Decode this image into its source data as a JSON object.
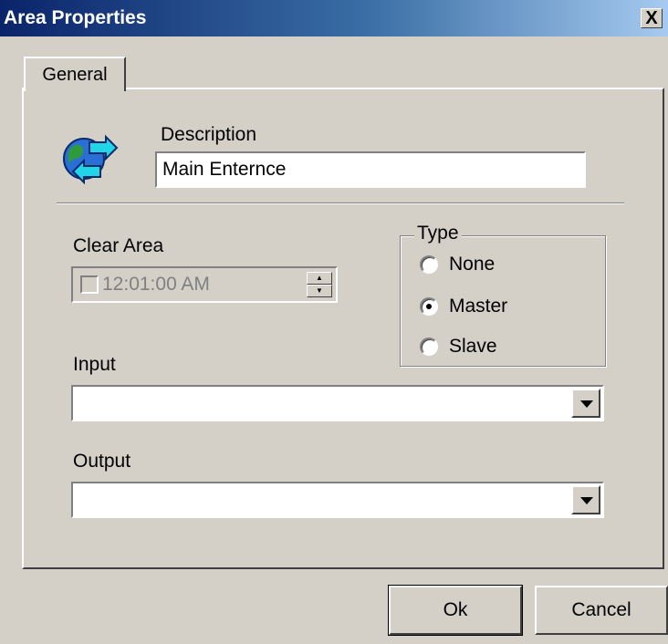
{
  "window": {
    "title": "Area Properties",
    "close_label": "X"
  },
  "tabs": [
    {
      "label": "General",
      "selected": true
    }
  ],
  "description": {
    "label": "Description",
    "value": "Main Enternce"
  },
  "clear_area": {
    "label": "Clear Area",
    "time_value": "12:01:00 AM",
    "checked": false,
    "enabled": false
  },
  "type": {
    "legend": "Type",
    "options": [
      {
        "label": "None",
        "selected": false
      },
      {
        "label": "Master",
        "selected": true
      },
      {
        "label": "Slave",
        "selected": false
      }
    ]
  },
  "input": {
    "label": "Input",
    "value": ""
  },
  "output": {
    "label": "Output",
    "value": ""
  },
  "buttons": {
    "ok_label": "Ok",
    "cancel_label": "Cancel"
  },
  "colors": {
    "titlebar_start": "#0a246a",
    "titlebar_end": "#a6caf0",
    "face": "#d4d0c8"
  }
}
